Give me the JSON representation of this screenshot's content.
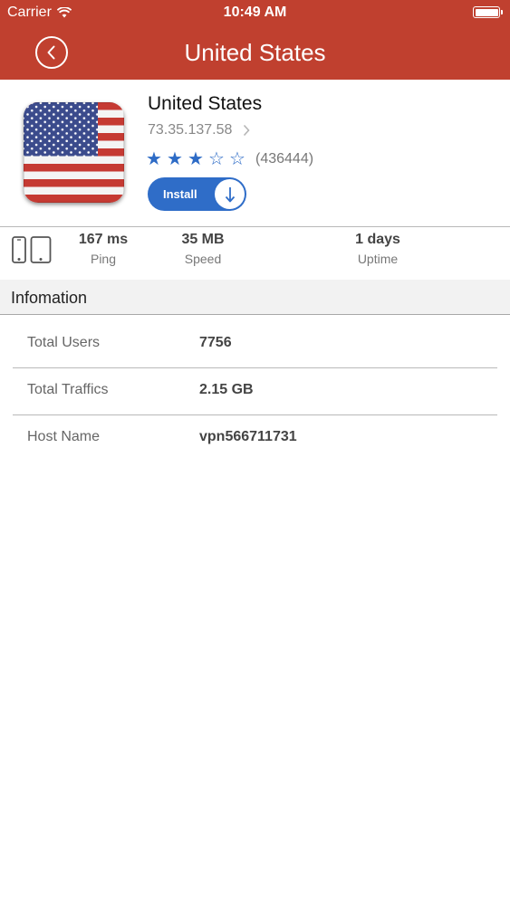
{
  "status_bar": {
    "carrier": "Carrier",
    "time": "10:49 AM"
  },
  "nav": {
    "title": "United States",
    "back_icon": "chevron-left-icon"
  },
  "server": {
    "name": "United States",
    "ip": "73.35.137.58",
    "rating_stars": 3,
    "rating_max": 5,
    "rating_count": "(436444)",
    "install_label": "Install",
    "flag_icon": "us-flag-icon"
  },
  "stats": {
    "ping": {
      "value": "167 ms",
      "label": "Ping"
    },
    "speed": {
      "value": "35 MB",
      "label": "Speed"
    },
    "uptime": {
      "value": "1 days",
      "label": "Uptime"
    }
  },
  "section": {
    "title": "Infomation"
  },
  "info": [
    {
      "label": "Total Users",
      "value": "7756"
    },
    {
      "label": "Total Traffics",
      "value": "2.15 GB"
    },
    {
      "label": "Host Name",
      "value": "vpn566711731"
    }
  ],
  "colors": {
    "header": "#c0402f",
    "accent": "#2f6dc8"
  }
}
